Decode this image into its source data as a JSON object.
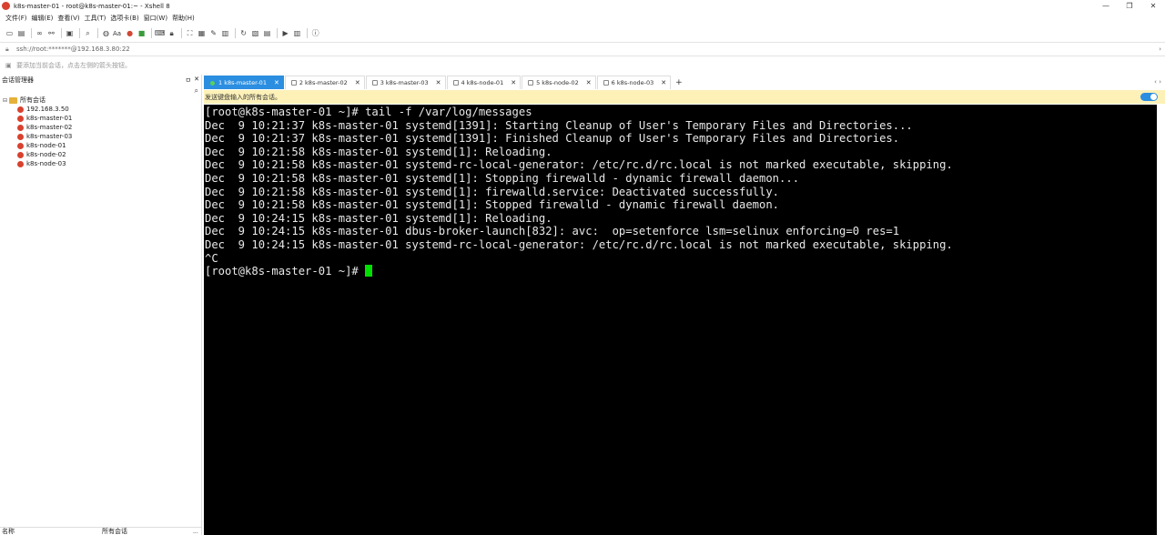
{
  "window": {
    "title": "k8s-master-01 - root@k8s-master-01:~ - Xshell 8",
    "controls": [
      "—",
      "❐",
      "✕"
    ]
  },
  "menu": [
    "文件(F)",
    "编辑(E)",
    "查看(V)",
    "工具(T)",
    "选项卡(B)",
    "窗口(W)",
    "帮助(H)"
  ],
  "toolbar": {
    "font_label": "Aa"
  },
  "address": {
    "value": "ssh://root:*******@192.168.3.80:22"
  },
  "hint": {
    "text": "要添加当前会话，点击左侧的箭头按钮。"
  },
  "sidebar": {
    "title": "会话管理器",
    "pin": "ㅁ",
    "close": "✕",
    "root_label": "所有会话",
    "sessions": [
      "192.168.3.50",
      "k8s-master-01",
      "k8s-master-02",
      "k8s-master-03",
      "k8s-node-01",
      "k8s-node-02",
      "k8s-node-03"
    ],
    "footer": {
      "col1": "名称",
      "col2": "所有会话",
      "dots": "..."
    }
  },
  "tabs": [
    {
      "label": "1 k8s-master-01",
      "active": true
    },
    {
      "label": "2 k8s-master-02",
      "active": false
    },
    {
      "label": "3 k8s-master-03",
      "active": false
    },
    {
      "label": "4 k8s-node-01",
      "active": false
    },
    {
      "label": "5 k8s-node-02",
      "active": false
    },
    {
      "label": "6 k8s-node-03",
      "active": false
    }
  ],
  "tab_add": "+",
  "tab_nav": "‹ ›",
  "sendbar": {
    "text": "发送键盘输入的所有会话。"
  },
  "terminal": {
    "lines": [
      "[root@k8s-master-01 ~]# tail -f /var/log/messages",
      "Dec  9 10:21:37 k8s-master-01 systemd[1391]: Starting Cleanup of User's Temporary Files and Directories...",
      "Dec  9 10:21:37 k8s-master-01 systemd[1391]: Finished Cleanup of User's Temporary Files and Directories.",
      "Dec  9 10:21:58 k8s-master-01 systemd[1]: Reloading.",
      "Dec  9 10:21:58 k8s-master-01 systemd-rc-local-generator: /etc/rc.d/rc.local is not marked executable, skipping.",
      "Dec  9 10:21:58 k8s-master-01 systemd[1]: Stopping firewalld - dynamic firewall daemon...",
      "Dec  9 10:21:58 k8s-master-01 systemd[1]: firewalld.service: Deactivated successfully.",
      "Dec  9 10:21:58 k8s-master-01 systemd[1]: Stopped firewalld - dynamic firewall daemon.",
      "Dec  9 10:24:15 k8s-master-01 systemd[1]: Reloading.",
      "Dec  9 10:24:15 k8s-master-01 dbus-broker-launch[832]: avc:  op=setenforce lsm=selinux enforcing=0 res=1",
      "Dec  9 10:24:15 k8s-master-01 systemd-rc-local-generator: /etc/rc.d/rc.local is not marked executable, skipping.",
      "^C"
    ],
    "prompt": "[root@k8s-master-01 ~]# ",
    "background": "#000000",
    "foreground": "#e8e8e8",
    "cursor_color": "#00e000"
  },
  "colors": {
    "accent": "#2b8ee0",
    "sendbar_bg": "#fdf1b8",
    "brand_red": "#d9412f"
  }
}
